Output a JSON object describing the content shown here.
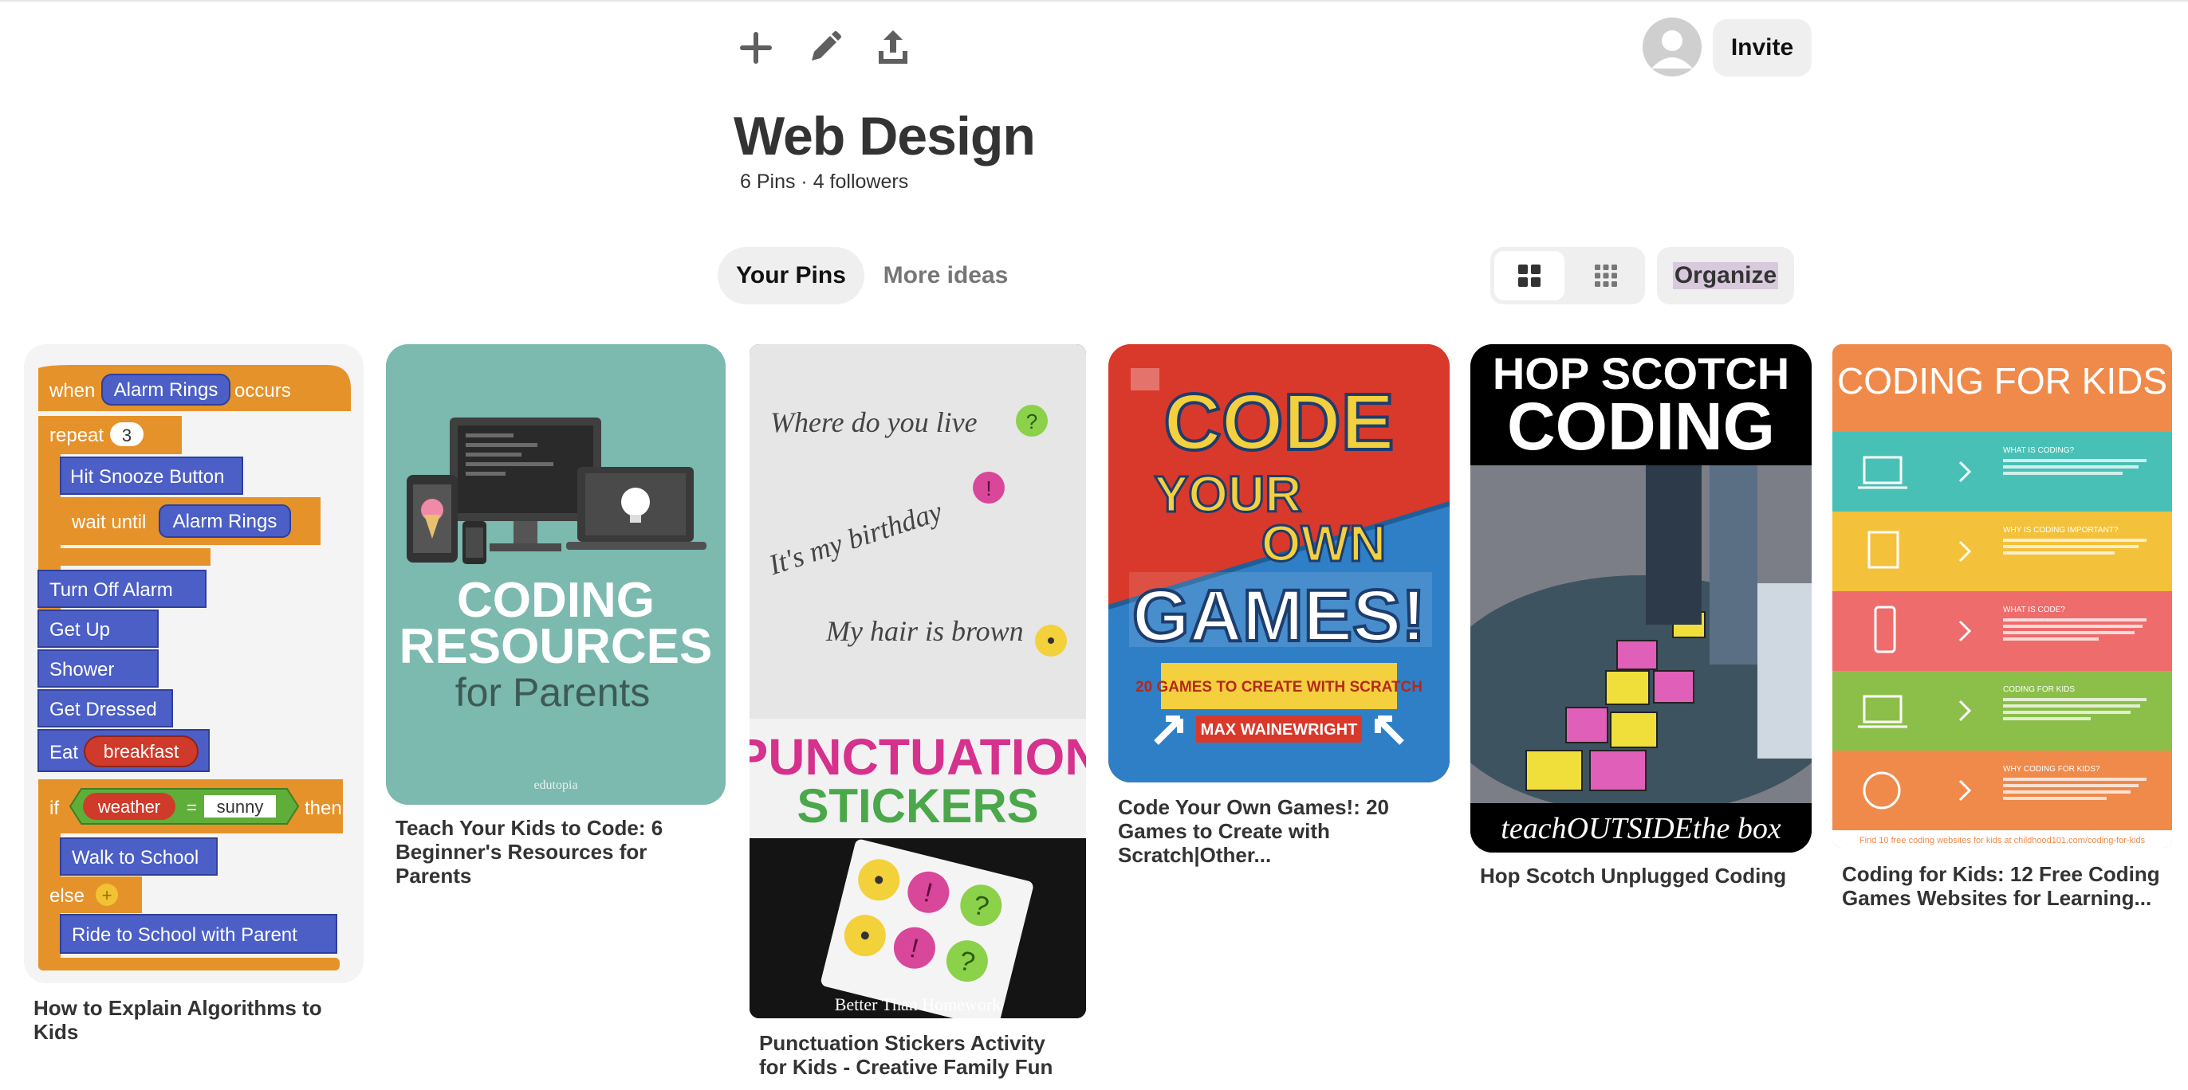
{
  "toolbar": {
    "add_icon": "plus-icon",
    "edit_icon": "pencil-icon",
    "share_icon": "share-icon"
  },
  "header": {
    "invite_label": "Invite"
  },
  "board": {
    "title": "Web Design",
    "stats": "6 Pins · 4 followers"
  },
  "tabs": [
    {
      "label": "Your Pins",
      "active": true
    },
    {
      "label": "More ideas",
      "active": false
    }
  ],
  "view": {
    "organize_label": "Organize"
  },
  "pins": [
    {
      "title": "How to Explain Algorithms to Kids",
      "blocks": {
        "when": "when",
        "trigger": "Alarm Rings",
        "occurs": "occurs",
        "repeat": "repeat",
        "repeat_count": "3",
        "snooze": "Hit Snooze Button",
        "wait_until": "wait until",
        "wait_target": "Alarm Rings",
        "turn_off": "Turn Off Alarm",
        "get_up": "Get Up",
        "shower": "Shower",
        "get_dressed": "Get Dressed",
        "eat": "Eat",
        "food": "breakfast",
        "if": "if",
        "weather": "weather",
        "equals": "=",
        "sunny": "sunny",
        "then": "then",
        "walk": "Walk to School",
        "else": "else",
        "ride": "Ride to School with Parent"
      }
    },
    {
      "title": "Teach Your Kids to Code: 6 Beginner's Resources for Parents",
      "image_text": {
        "line1": "CODING",
        "line2": "RESOURCES",
        "line3": "for Parents",
        "brand": "edutopia"
      }
    },
    {
      "title": "Punctuation Stickers Activity for Kids - Creative Family Fun",
      "image_text": {
        "q1": "Where do you live",
        "q2": "It's my birthday",
        "q3": "My hair is brown",
        "banner1": "PUNCTUATION",
        "banner2": "STICKERS",
        "credit": "Better Than Homework"
      }
    },
    {
      "title": "Code Your Own Games!: 20 Games to Create with Scratch|Other...",
      "image_text": {
        "line1": "CODE",
        "line2": "YOUR",
        "line3": "OWN",
        "line4": "GAMES!",
        "sub": "20 GAMES TO CREATE WITH SCRATCH",
        "author": "MAX WAINEWRIGHT"
      }
    },
    {
      "title": "Hop Scotch Unplugged Coding",
      "image_text": {
        "line1": "HOP SCOTCH",
        "line2": "CODING",
        "footer": "teachOUTSIDEthe box"
      }
    },
    {
      "title": "Coding for Kids: 12 Free Coding Games Websites for Learning...",
      "image_text": {
        "header": "CODING FOR KIDS",
        "sections": [
          "WHAT IS CODING?",
          "WHY IS CODING IMPORTANT?",
          "WHAT IS CODE?",
          "CODING FOR KIDS",
          "WHY CODING FOR KIDS?"
        ],
        "footer": "Find 10 free coding websites for kids at childhood101.com/coding-for-kids"
      }
    }
  ]
}
